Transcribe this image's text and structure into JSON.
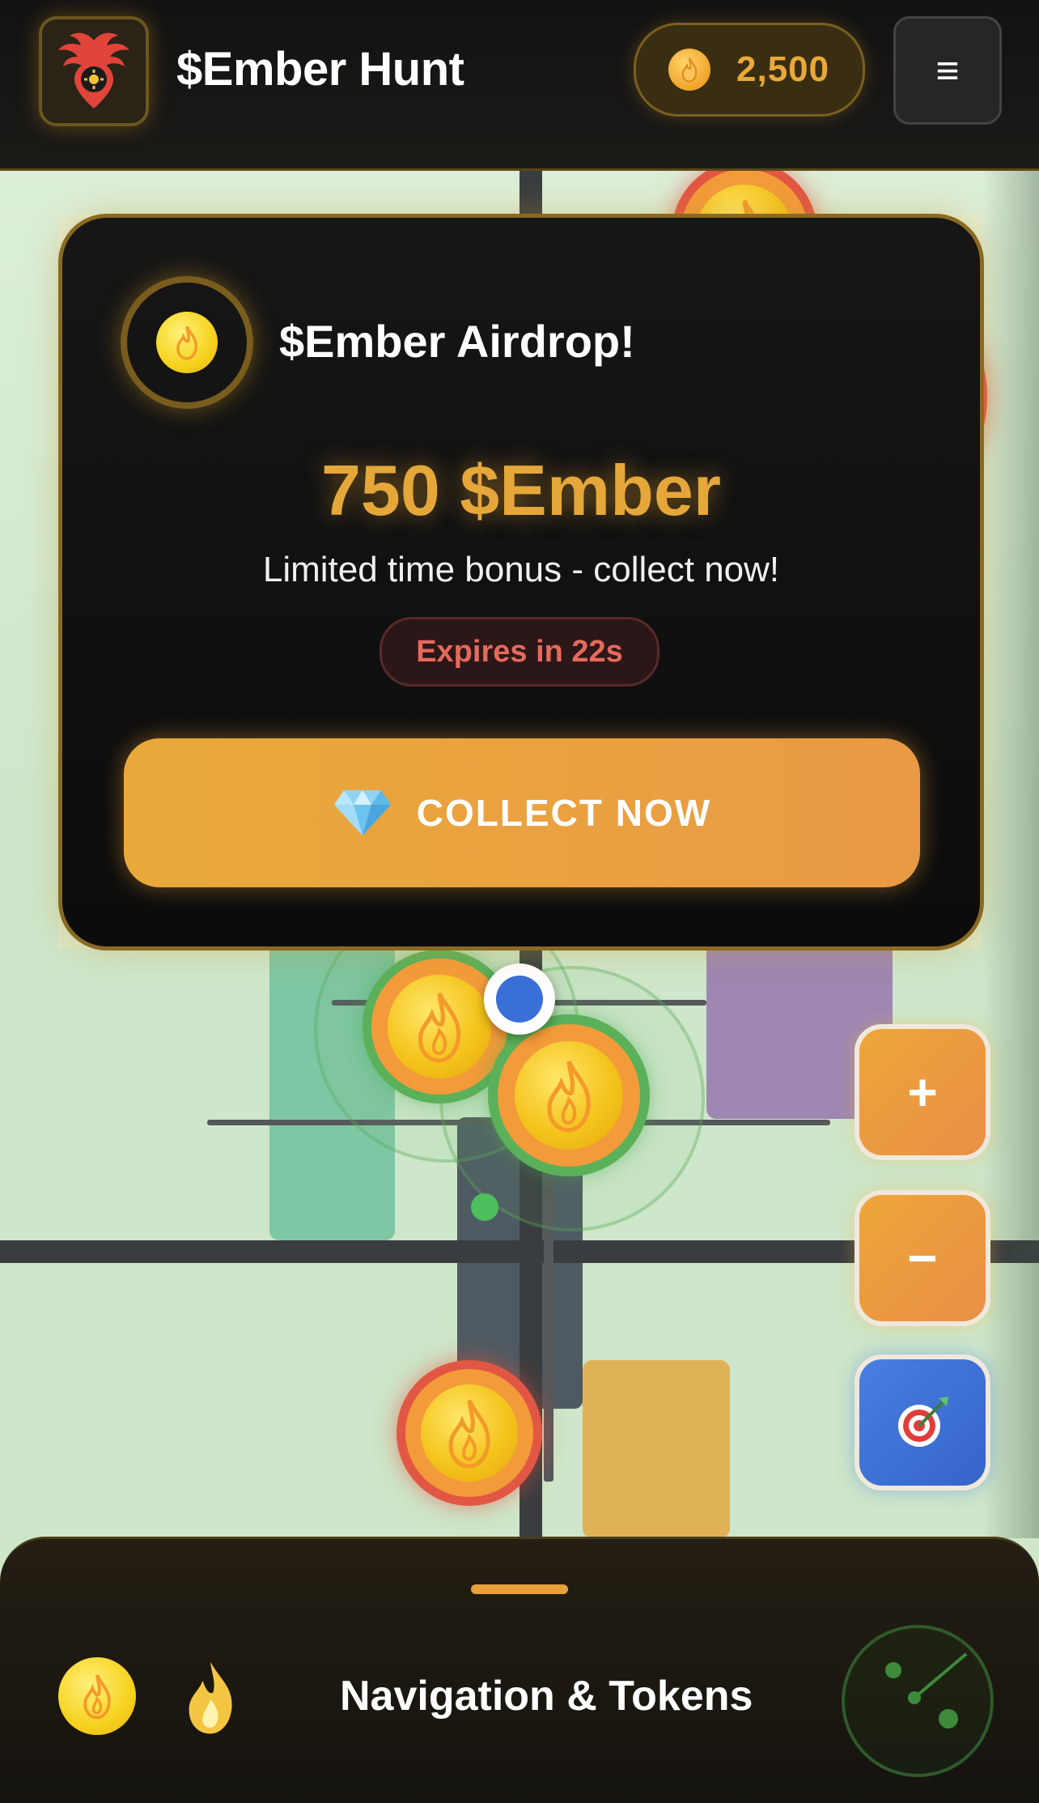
{
  "header": {
    "title": "$Ember Hunt",
    "balance": "2,500",
    "menu_glyph": "≡"
  },
  "airdrop": {
    "title": "$Ember Airdrop!",
    "amount": "750 $Ember",
    "subtitle": "Limited time bonus - collect now!",
    "expires": "Expires in 22s",
    "button_label": "COLLECT NOW",
    "button_icon": "gem-icon"
  },
  "controls": {
    "zoom_in": "+",
    "zoom_out": "−",
    "target_icon": "target-icon"
  },
  "bottom_panel": {
    "title": "Navigation & Tokens"
  },
  "colors": {
    "accent": "#e8a93a",
    "danger": "#e56a5c",
    "locate": "#3a6fd8"
  }
}
